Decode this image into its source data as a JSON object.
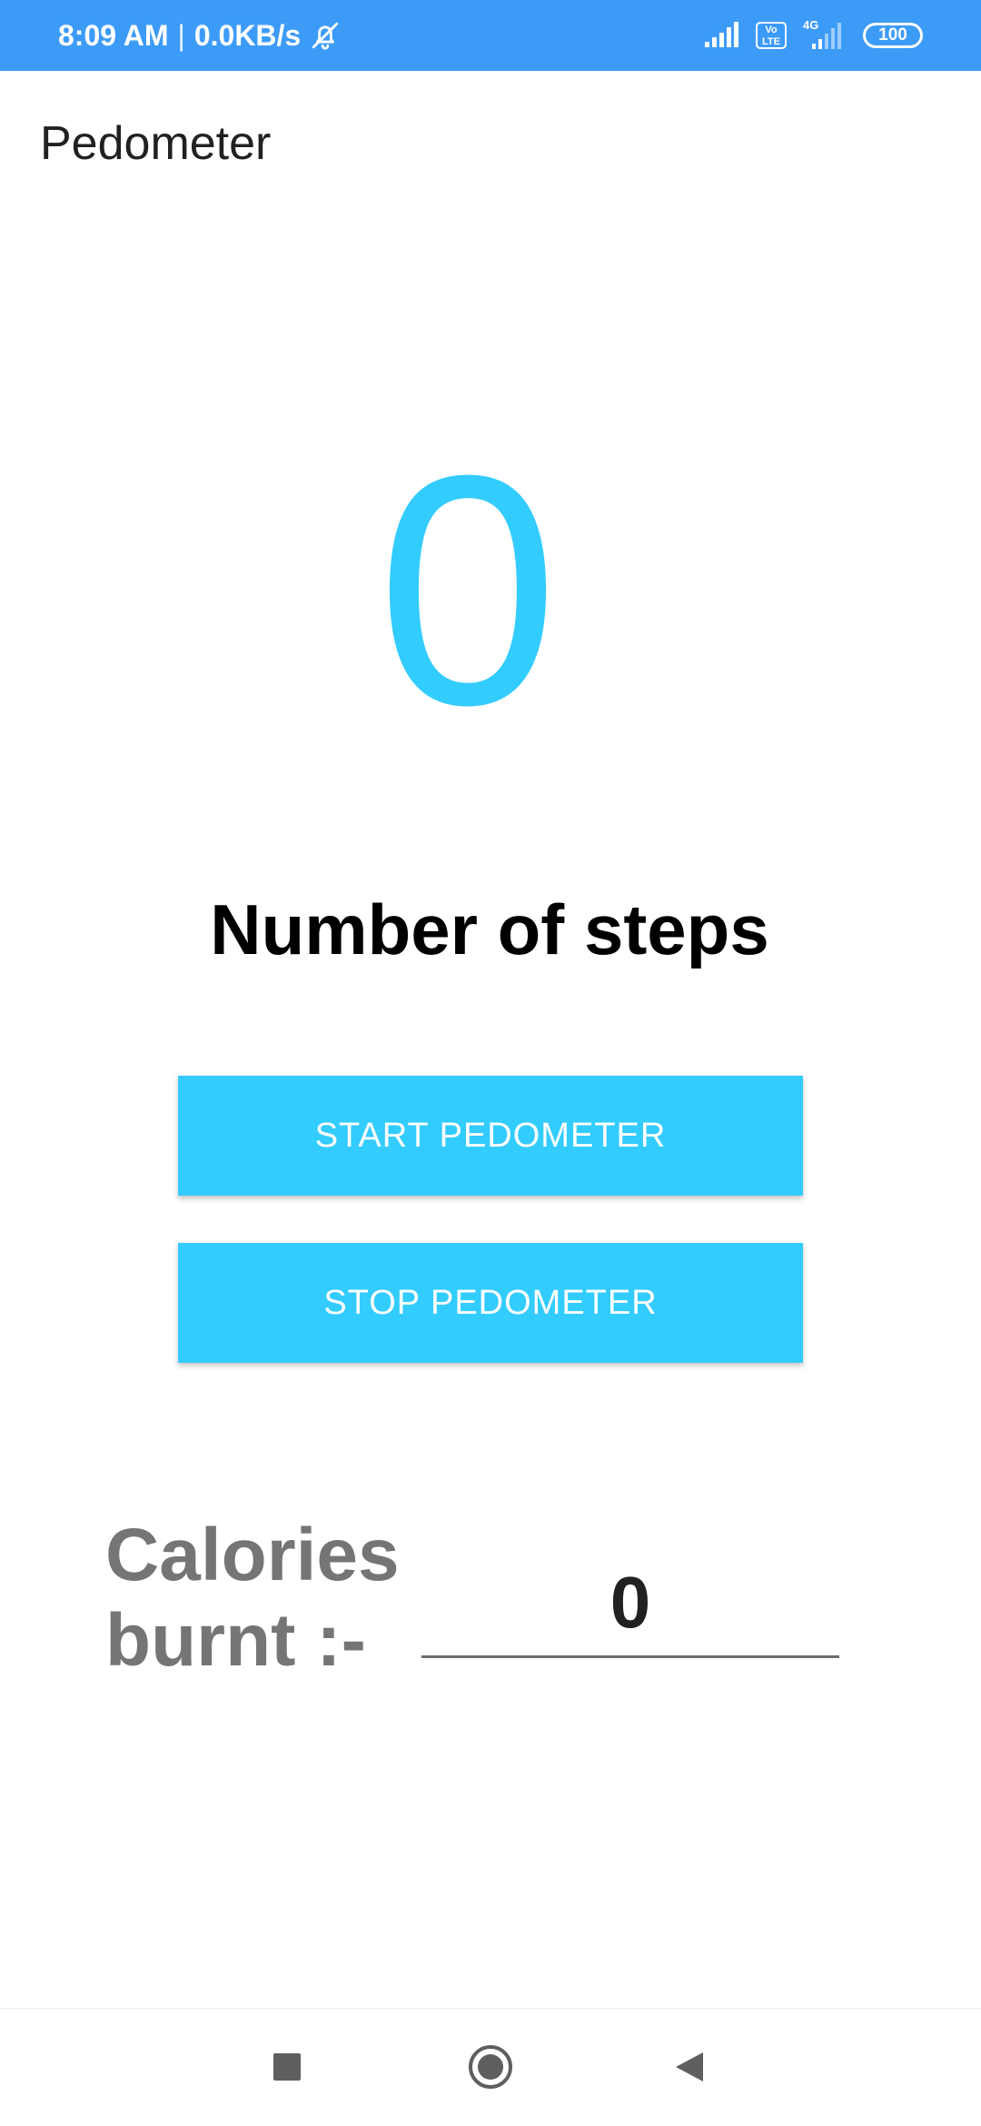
{
  "status_bar": {
    "time": "8:09 AM",
    "separator": "|",
    "speed": "0.0KB/s",
    "volte": "Vo LTE",
    "network": "4G",
    "battery": "100",
    "icons": [
      "bell-off-icon",
      "signal-icon",
      "volte-icon",
      "network-4g-icon",
      "battery-icon"
    ],
    "background": "#3d9bf8"
  },
  "app": {
    "title": "Pedometer"
  },
  "steps": {
    "count": "0",
    "label": "Number of steps",
    "color": "#33ccff"
  },
  "buttons": {
    "start_label": "START PEDOMETER",
    "stop_label": "STOP PEDOMETER",
    "color": "#33ccff"
  },
  "calories": {
    "label": "Calories burnt :-",
    "value": "0"
  },
  "nav_bar": {
    "icons": [
      "recents-icon",
      "home-icon",
      "back-icon"
    ]
  }
}
